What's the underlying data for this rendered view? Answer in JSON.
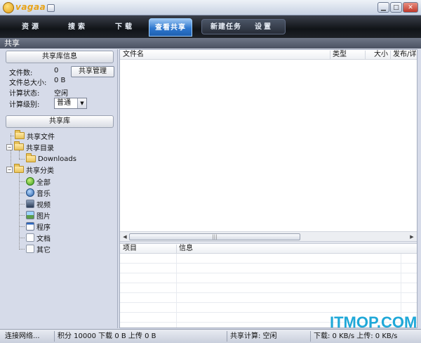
{
  "titlebar": {
    "brand": "vagaa",
    "minimize": "▁",
    "maximize": "□",
    "close": "✕"
  },
  "nav": {
    "tabs": [
      {
        "label": "资源"
      },
      {
        "label": "搜索"
      },
      {
        "label": "下载"
      },
      {
        "label": "查看共享",
        "active": true
      },
      {
        "label": "新建任务"
      },
      {
        "label": "设置"
      }
    ]
  },
  "section_title": "共享",
  "left": {
    "info_header": "共享库信息",
    "file_count_label": "文件数:",
    "file_count_value": "0",
    "total_size_label": "文件总大小:",
    "total_size_value": "0 B",
    "calc_status_label": "计算状态:",
    "calc_status_value": "空闲",
    "calc_level_label": "计算级别:",
    "calc_level_value": "普通",
    "manage_button": "共享管理",
    "library_header": "共享库",
    "tree": {
      "shared_files": "共享文件",
      "shared_dirs": "共享目录",
      "downloads": "Downloads",
      "shared_categories": "共享分类",
      "categories": [
        "全部",
        "音乐",
        "视频",
        "图片",
        "程序",
        "文档",
        "其它"
      ],
      "expander_minus": "−"
    }
  },
  "right": {
    "columns": [
      "文件名",
      "类型",
      "大小",
      "发布/详"
    ],
    "detail_columns": [
      "项目",
      "信息"
    ],
    "scroll_left": "◀",
    "scroll_right": "▶",
    "scroll_grip": "|||"
  },
  "status": {
    "network": "连接网络...",
    "points": "积分 10000 下载 0 B 上传 0 B",
    "share_calc": "共享计算: 空闲",
    "speed": "下载: 0 KB/s  上传: 0 KB/s"
  },
  "watermark": "ITMOP.COM",
  "colors": {
    "accent": "#2f78cf",
    "nav_bg": "#111418",
    "watermark": "#1fa8d8"
  }
}
